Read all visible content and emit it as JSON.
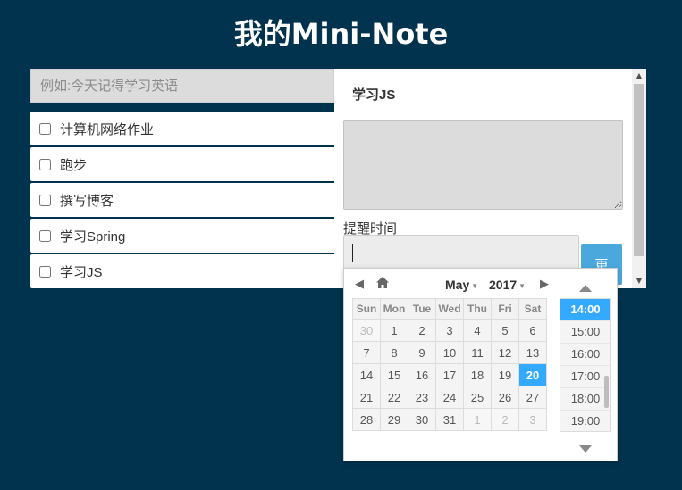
{
  "app": {
    "title": "我的Mini-Note"
  },
  "new_task": {
    "placeholder": "例如:今天记得学习英语"
  },
  "tasks": [
    {
      "label": "计算机网络作业"
    },
    {
      "label": "跑步"
    },
    {
      "label": "撰写博客"
    },
    {
      "label": "学习Spring"
    },
    {
      "label": "学习JS"
    }
  ],
  "detail": {
    "title": "学习JS",
    "remind_label": "提醒时间",
    "update_label": "更"
  },
  "picker": {
    "month": "May",
    "year": "2017",
    "weekdays": [
      "Sun",
      "Mon",
      "Tue",
      "Wed",
      "Thu",
      "Fri",
      "Sat"
    ],
    "weeks": [
      [
        "30",
        "1",
        "2",
        "3",
        "4",
        "5",
        "6"
      ],
      [
        "7",
        "8",
        "9",
        "10",
        "11",
        "12",
        "13"
      ],
      [
        "14",
        "15",
        "16",
        "17",
        "18",
        "19",
        "20"
      ],
      [
        "21",
        "22",
        "23",
        "24",
        "25",
        "26",
        "27"
      ],
      [
        "28",
        "29",
        "30",
        "31",
        "1",
        "2",
        "3"
      ]
    ],
    "selected_day": "20",
    "times": [
      "14:00",
      "15:00",
      "16:00",
      "17:00",
      "18:00",
      "19:00"
    ],
    "selected_time": "14:00"
  },
  "colors": {
    "background": "#01324e",
    "accent": "#33aaff",
    "button": "#4aa8dd"
  }
}
